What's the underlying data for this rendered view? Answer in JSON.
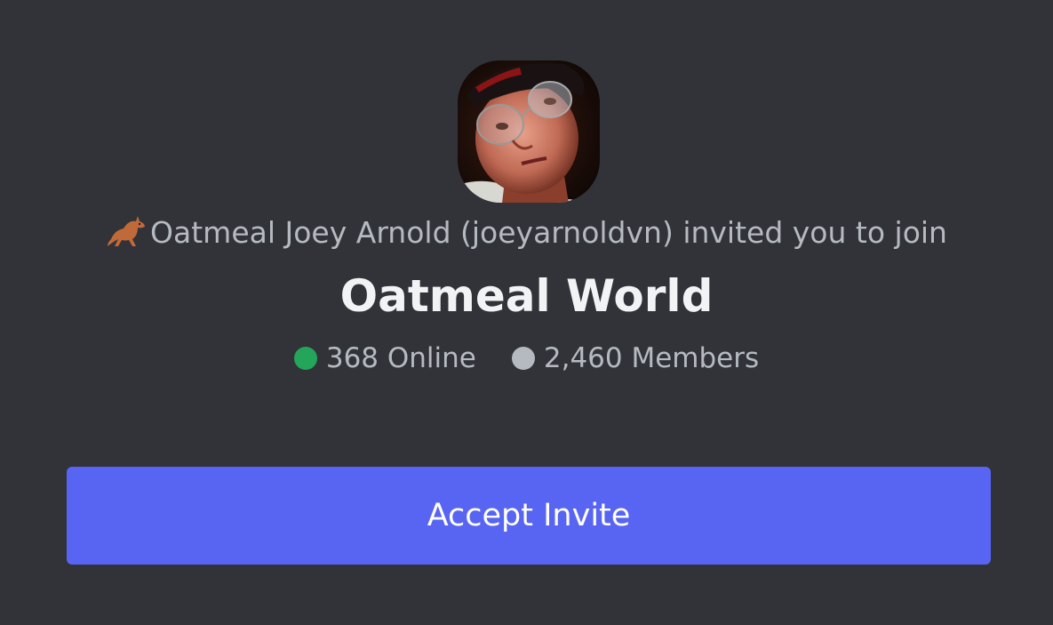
{
  "invite": {
    "emoji": "kangaroo-emoji",
    "inviter_text": "Oatmeal Joey Arnold (joeyarnoldvn) invited you to join",
    "server_name": "Oatmeal World",
    "online_count": "368 Online",
    "member_count": "2,460 Members",
    "accept_label": "Accept Invite"
  },
  "colors": {
    "background": "#313338",
    "button": "#5865f2",
    "online_dot": "#23a55a",
    "members_dot": "#b5bac1",
    "title_text": "#f2f3f5",
    "muted_text": "#b5bac1"
  }
}
